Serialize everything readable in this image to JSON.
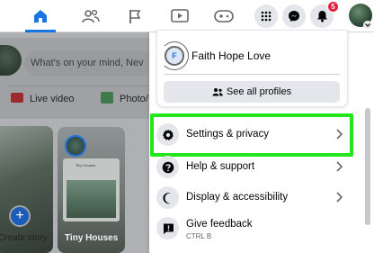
{
  "topbar": {
    "notification_count": "5"
  },
  "feed": {
    "composer_placeholder": "What's on your mind, Nev",
    "live_video_label": "Live video",
    "photo_label": "Photo/",
    "create_story_label": "Create story",
    "story_card_label": "Tiny Houses",
    "story_post_title": "Tiny Houses"
  },
  "menu": {
    "profile_name": "Faith Hope Love",
    "profile_initial": "F",
    "see_all_profiles": "See all profiles",
    "items": [
      {
        "label": "Settings & privacy",
        "icon": "gear-icon"
      },
      {
        "label": "Help & support",
        "icon": "question-icon"
      },
      {
        "label": "Display & accessibility",
        "icon": "moon-icon"
      },
      {
        "label": "Give feedback",
        "sublabel": "CTRL B",
        "icon": "feedback-icon"
      }
    ]
  },
  "colors": {
    "accent": "#1b74e4",
    "highlight": "#22e51a",
    "badge": "#e41e3f"
  }
}
